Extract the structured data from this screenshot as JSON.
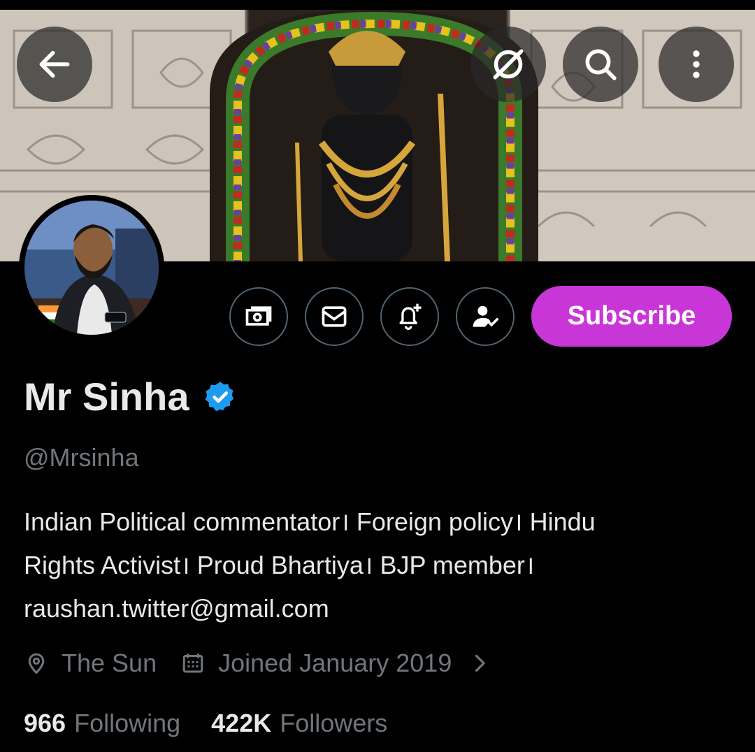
{
  "header": {
    "back_icon": "arrow-left-icon",
    "grok_icon": "slashed-circle-icon",
    "search_icon": "search-icon",
    "more_icon": "more-vertical-icon"
  },
  "actions": {
    "tip_icon": "money-icon",
    "message_icon": "envelope-icon",
    "notify_icon": "bell-plus-icon",
    "follow_icon": "person-check-icon",
    "subscribe_label": "Subscribe",
    "subscribe_color": "#c936d8"
  },
  "profile": {
    "name": "Mr Sinha",
    "handle": "@Mrsinha",
    "verified_color": "#1d9bf0",
    "bio_lines": [
      "Indian Political commentator। Foreign policy। Hindu",
      "Rights Activist। Proud Bhartiya। BJP member।",
      "raushan.twitter@gmail.com"
    ],
    "location": "The Sun",
    "joined": "Joined January 2019",
    "following_count": "966",
    "following_label": "Following",
    "followers_count": "422K",
    "followers_label": "Followers"
  }
}
